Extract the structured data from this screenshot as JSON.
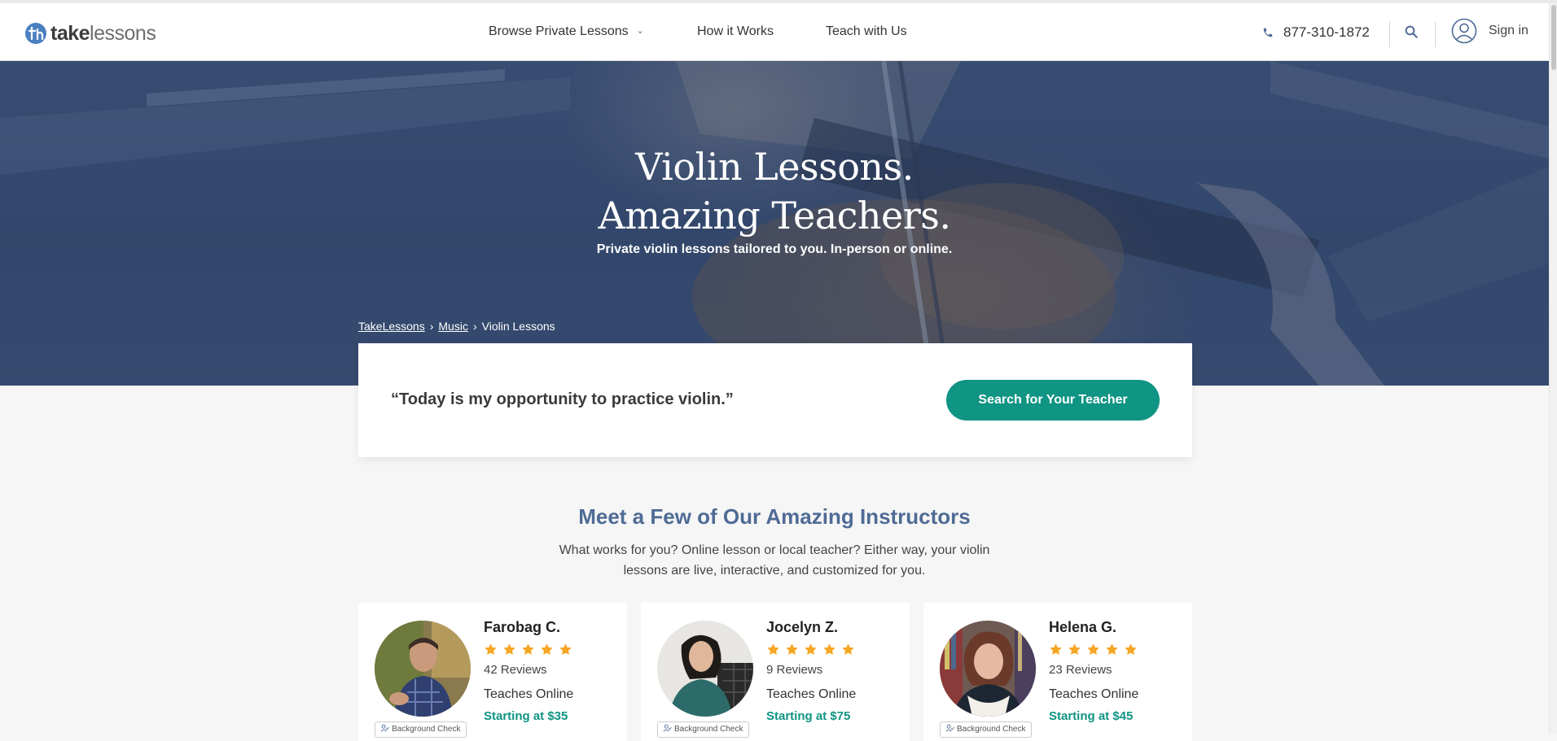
{
  "colors": {
    "accent_green": "#109483",
    "heading_blue": "#4f6b95",
    "star_gold": "#f5a623",
    "logo_blue": "#4a7fc1"
  },
  "header": {
    "logo": {
      "bold": "take",
      "light": "lessons"
    },
    "nav": [
      {
        "label": "Browse Private Lessons",
        "has_dropdown": true,
        "icon": "chevron-down-icon"
      },
      {
        "label": "How it Works"
      },
      {
        "label": "Teach with Us"
      }
    ],
    "phone": "877-310-1872",
    "sign_in": "Sign in"
  },
  "hero": {
    "title_line1": "Violin Lessons.",
    "title_line2": "Amazing Teachers.",
    "subtitle": "Private violin lessons tailored to you. In-person or online.",
    "breadcrumb": [
      "TakeLessons",
      "Music",
      "Violin Lessons"
    ]
  },
  "quote_card": {
    "quote": "“Today is my opportunity to practice violin.”",
    "button": "Search for Your Teacher"
  },
  "instructors": {
    "title": "Meet a Few of Our Amazing Instructors",
    "description": "What works for you? Online lesson or local teacher? Either way, your violin lessons are live, interactive, and customized for you.",
    "badge": "Background Check",
    "items": [
      {
        "name": "Farobag C.",
        "rating": 5,
        "reviews": "42 Reviews",
        "mode": "Teaches Online",
        "price": "Starting at $35"
      },
      {
        "name": "Jocelyn Z.",
        "rating": 5,
        "reviews": "9 Reviews",
        "mode": "Teaches Online",
        "price": "Starting at $75"
      },
      {
        "name": "Helena G.",
        "rating": 5,
        "reviews": "23 Reviews",
        "mode": "Teaches Online",
        "price": "Starting at $45"
      }
    ]
  }
}
